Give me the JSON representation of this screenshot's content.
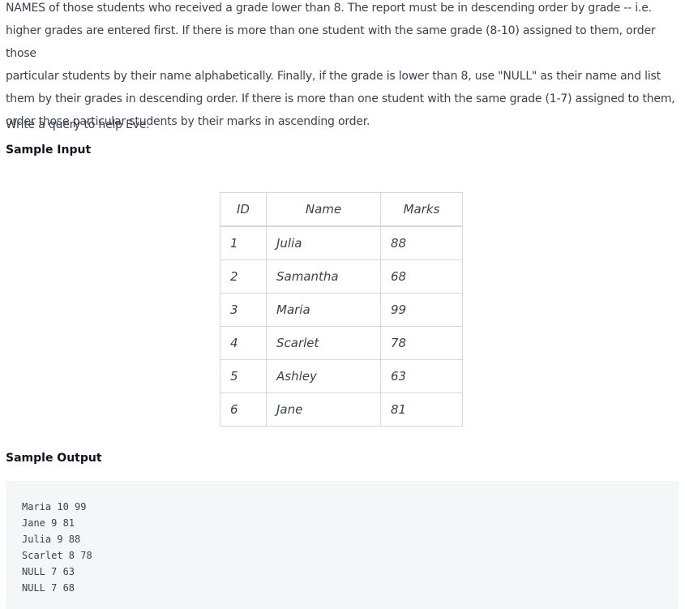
{
  "problem": {
    "lines": [
      "NAMES of those students who received a grade lower than 8. The report must be in descending order by grade -- i.e.",
      "higher grades are entered first. If there is more than one student with the same grade (8-10) assigned to them, order those",
      "particular students by their name alphabetically. Finally, if the grade is lower than 8, use \"NULL\" as their name and list",
      "them by their grades in descending order. If there is more than one student with the same grade (1-7) assigned to them,",
      "order those particular students by their marks in ascending order."
    ],
    "question": "Write a query to help Eve."
  },
  "sample_input": {
    "heading": "Sample Input",
    "columns": [
      "ID",
      "Name",
      "Marks"
    ],
    "rows": [
      [
        "1",
        "Julia",
        "88"
      ],
      [
        "2",
        "Samantha",
        "68"
      ],
      [
        "3",
        "Maria",
        "99"
      ],
      [
        "4",
        "Scarlet",
        "78"
      ],
      [
        "5",
        "Ashley",
        "63"
      ],
      [
        "6",
        "Jane",
        "81"
      ]
    ]
  },
  "sample_output": {
    "heading": "Sample Output",
    "lines": [
      "Maria 10 99",
      "Jane 9 81",
      "Julia 9 88",
      "Scarlet 8 78",
      "NULL 7 63",
      "NULL 7 68"
    ]
  }
}
